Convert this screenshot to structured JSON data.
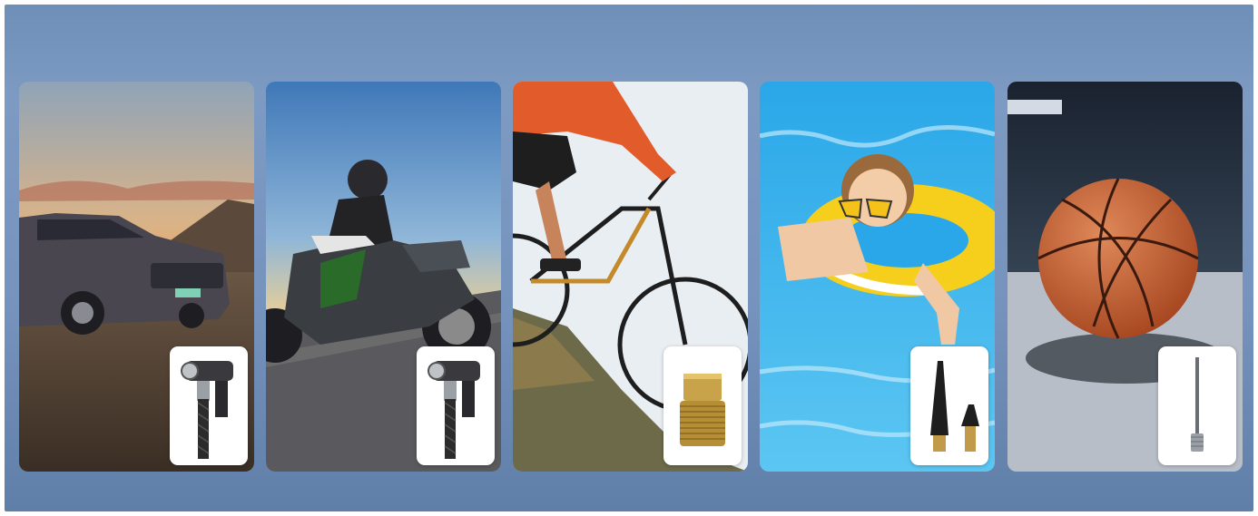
{
  "cards": [
    {
      "scene": "car-at-sunset",
      "accessory": "air-chuck-icon"
    },
    {
      "scene": "motorcycle-rider",
      "accessory": "air-chuck-icon"
    },
    {
      "scene": "mountain-bike",
      "accessory": "presta-valve-adapter-icon"
    },
    {
      "scene": "child-in-swim-ring",
      "accessory": "inflation-cone-nozzles-icon"
    },
    {
      "scene": "basketball",
      "accessory": "ball-needle-icon"
    }
  ],
  "colors": {
    "frame": "#7593bd",
    "badge": "#ffffff"
  }
}
